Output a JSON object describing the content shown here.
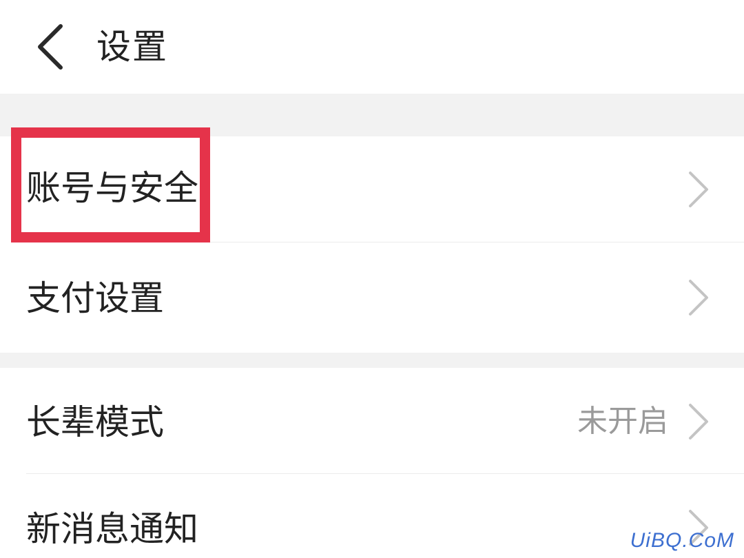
{
  "header": {
    "back_icon": "chevron-left-icon",
    "title": "设置"
  },
  "settings": {
    "items": [
      {
        "label": "账号与安全",
        "value": "",
        "icon": "chevron-right-icon",
        "highlighted": true
      },
      {
        "label": "支付设置",
        "value": "",
        "icon": "chevron-right-icon"
      },
      {
        "label": "长辈模式",
        "value": "未开启",
        "icon": "chevron-right-icon"
      },
      {
        "label": "新消息通知",
        "value": "",
        "icon": "chevron-right-icon"
      }
    ]
  },
  "annotation": {
    "highlight_color": "#e5334a"
  },
  "watermark": {
    "text": "UiBQ.CoM",
    "color": "#3d6fd0"
  }
}
